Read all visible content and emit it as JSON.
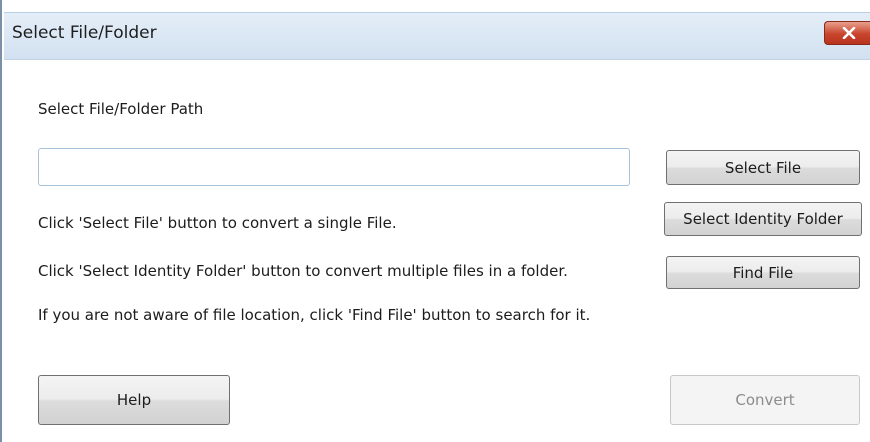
{
  "window": {
    "title": "Select File/Folder",
    "close_label": "Close"
  },
  "main": {
    "path_label": "Select File/Folder Path",
    "path_input": {
      "value": "",
      "placeholder": ""
    },
    "instructions": [
      "Click 'Select File' button to convert a single File.",
      "Click 'Select Identity Folder' button to convert multiple files in a folder.",
      "If you are not aware of file location, click 'Find File' button to search for it."
    ]
  },
  "buttons": {
    "select_file": "Select File",
    "select_identity_folder": "Select Identity Folder",
    "find_file": "Find File",
    "help": "Help",
    "convert": "Convert"
  },
  "state": {
    "convert_enabled": false
  },
  "colors": {
    "titlebar": "#d2e1f1",
    "close_button": "#c8442c",
    "input_border": "#a9c2dc"
  }
}
